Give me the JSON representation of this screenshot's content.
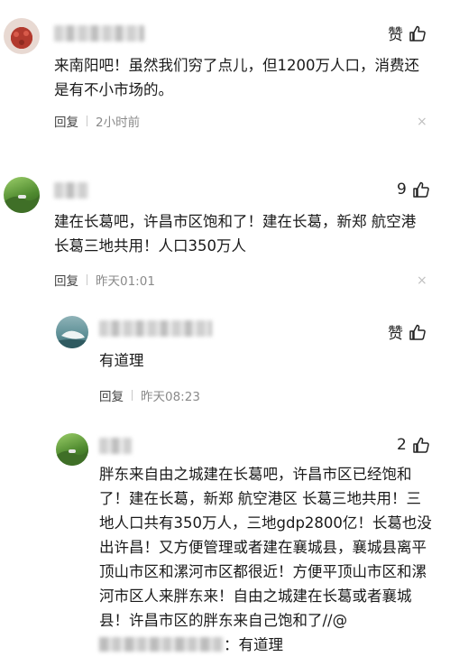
{
  "comments": [
    {
      "likes": "赞",
      "text": "来南阳吧！虽然我们穷了点儿，但1200万人口，消费还是有不小市场的。",
      "reply_label": "回复",
      "time": "2小时前",
      "close_glyph": "×"
    },
    {
      "likes": "9",
      "text": "建在长葛吧，许昌市区饱和了！建在长葛，新郑 航空港 长葛三地共用！人口350万人",
      "reply_label": "回复",
      "time": "昨天01:01",
      "close_glyph": "×"
    }
  ],
  "replies": [
    {
      "likes": "赞",
      "text": "有道理",
      "reply_label": "回复",
      "time": "昨天08:23"
    },
    {
      "likes": "2",
      "text": "胖东来自由之城建在长葛吧，许昌市区已经饱和了！建在长葛，新郑 航空港区 长葛三地共用！三地人口共有350万人，三地gdp2800亿！长葛也没出许昌！又方便管理或者建在襄城县，襄城县离平顶山市区和漯河市区都很近！方便平顶山市区和漯河市区人来胖东来！自由之城建在长葛或者襄城县！许昌市区的胖东来自己饱和了//@",
      "quote_suffix": "：有道理"
    }
  ],
  "icons": {
    "like": "thumbs-up-icon",
    "close": "close-icon"
  }
}
